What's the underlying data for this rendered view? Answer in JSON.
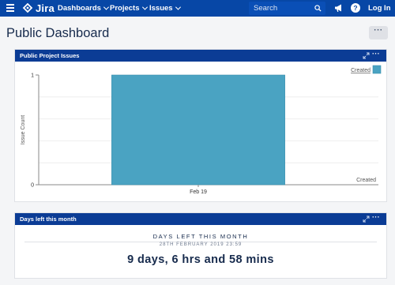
{
  "nav": {
    "logo_text": "Jira",
    "dashboards": "Dashboards",
    "projects": "Projects",
    "issues": "Issues",
    "search_placeholder": "Search",
    "help_glyph": "?",
    "login": "Log In"
  },
  "page": {
    "title": "Public Dashboard",
    "more_label": "···"
  },
  "gadgets": {
    "issues": {
      "title": "Public Project Issues",
      "menu_label": "···"
    },
    "days": {
      "title": "Days left this month",
      "menu_label": "···",
      "heading": "DAYS LEFT THIS MONTH",
      "date": "28TH FEBRUARY 2019 23:59",
      "value": "9 days, 6 hrs and 58 mins"
    }
  },
  "colors": {
    "nav": "#0747a6",
    "gadget_header": "#0b3c95",
    "bar": "#4aa3c2"
  },
  "chart_data": {
    "type": "bar",
    "categories": [
      "Feb 19"
    ],
    "series": [
      {
        "name": "Created",
        "values": [
          1
        ]
      }
    ],
    "xlabel": "Created",
    "ylabel": "Issue Count",
    "ylim": [
      0,
      1
    ],
    "yticks": [
      0,
      1
    ],
    "legend": "top-right"
  }
}
